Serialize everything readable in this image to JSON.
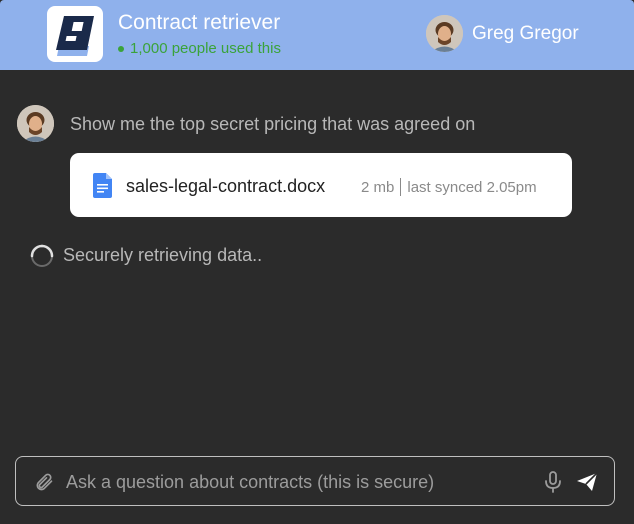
{
  "header": {
    "title": "Contract retriever",
    "usage": "1,000 people used this",
    "user_name": "Greg Gregor"
  },
  "chat": {
    "message": "Show me the top secret pricing that was agreed on",
    "file": {
      "name": "sales-legal-contract.docx",
      "size": "2 mb",
      "synced": "last synced 2.05pm"
    },
    "status": "Securely retrieving data.."
  },
  "composer": {
    "placeholder": "Ask a question about contracts (this is secure)"
  },
  "colors": {
    "header_bg": "#8fb1ec",
    "background": "#2b2b2b",
    "usage_green": "#3aa33a",
    "doc_blue": "#4285f4"
  },
  "icons": [
    "app-logo",
    "avatar",
    "google-doc-icon",
    "spinner-icon",
    "paperclip-icon",
    "microphone-icon",
    "send-icon"
  ]
}
